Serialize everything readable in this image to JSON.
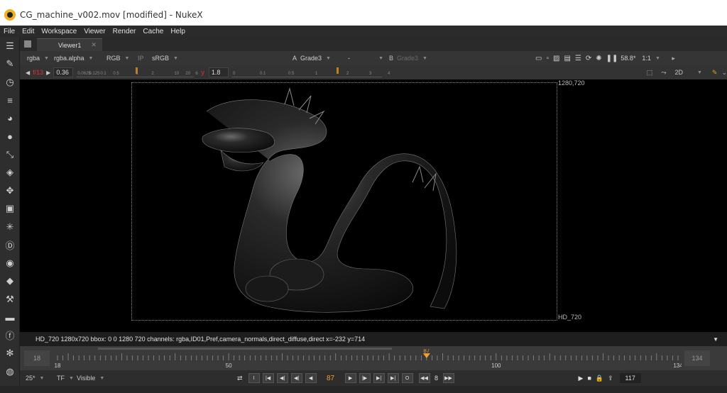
{
  "window": {
    "title": "CG_machine_v002.mov [modified] - NukeX"
  },
  "menu": [
    "File",
    "Edit",
    "Workspace",
    "Viewer",
    "Render",
    "Cache",
    "Help"
  ],
  "sidebar_icons": [
    "tool-sets-icon",
    "paint-icon",
    "time-icon",
    "channel-icon",
    "color-icon",
    "filter-icon",
    "keyer-icon",
    "merge-icon",
    "transform-icon",
    "3d-icon",
    "particles-icon",
    "deep-icon",
    "views-icon",
    "metadata-icon",
    "toolsets-icon",
    "other-icon",
    "furnace-icon",
    "settings-icon",
    "globe-icon"
  ],
  "tab": {
    "label": "Viewer1",
    "close": "✕"
  },
  "controls": {
    "channels": "rgba",
    "layer": "rgba.alpha",
    "display": "RGB",
    "ip": "IP",
    "lut": "sRGB",
    "a_label": "A",
    "a_input": "Grade3",
    "wipe": "-",
    "b_label": "B",
    "b_input": "Grade3",
    "zoom": "58.8*",
    "ratio": "1:1",
    "view_mode": "2D"
  },
  "gain": {
    "fstop": "f/13",
    "value": "0.36",
    "gamma_label": "y",
    "gamma_value": "1.8",
    "gain_ticks": [
      "0.0625",
      "0.125",
      "0.1",
      "0.5",
      "1",
      "2",
      "10",
      "20",
      "6"
    ],
    "gamma_ticks": [
      "0",
      "0.1",
      "0.5",
      "1",
      "2",
      "3",
      "4"
    ]
  },
  "viewer": {
    "format_top": "1280,720",
    "format_bottom": "HD_720"
  },
  "info": {
    "text": "HD_720 1280x720  bbox: 0 0 1280 720 channels: rgba,ID01,Pref,camera_normals,direct_diffuse,direct  x=-232 y=714"
  },
  "timeline": {
    "start": "18",
    "end": "134",
    "current": "87",
    "ticks": [
      "18",
      "50",
      "100",
      "134"
    ],
    "current_fraction": 0.595
  },
  "playback": {
    "fps": "25*",
    "tf": "TF",
    "visibility": "Visible",
    "frame": "87",
    "step": "8",
    "end_frame": "117",
    "in_btn": "I",
    "out_btn": "O"
  },
  "colors": {
    "accent": "#f0a030",
    "bg": "#323232"
  }
}
